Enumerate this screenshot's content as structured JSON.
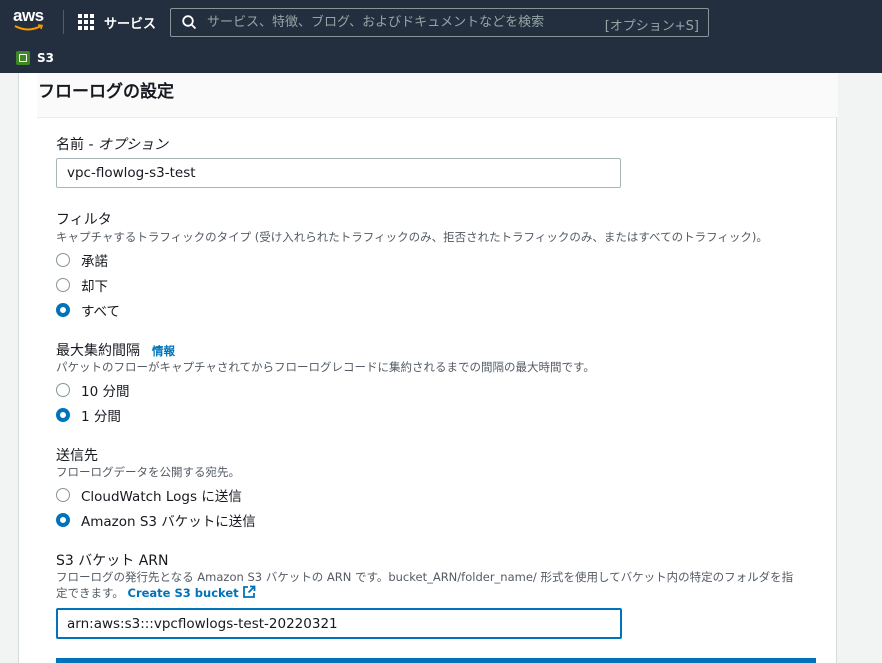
{
  "nav": {
    "logo_text": "aws",
    "services_label": "サービス",
    "search_placeholder": "サービス、特徴、ブログ、およびドキュメントなどを検索",
    "search_shortcut": "[オプション+S]",
    "favorite_label": "S3"
  },
  "panel": {
    "title": "フローログの設定"
  },
  "name_field": {
    "label": "名前 - ",
    "label_optional": "オプション",
    "value": "vpc-flowlog-s3-test"
  },
  "filter": {
    "label": "フィルタ",
    "description": "キャプチャするトラフィックのタイプ (受け入れられたトラフィックのみ、拒否されたトラフィックのみ、またはすべてのトラフィック)。",
    "options": [
      "承諾",
      "却下",
      "すべて"
    ],
    "selected": "すべて"
  },
  "aggregation": {
    "label": "最大集約間隔",
    "info_link": "情報",
    "description": "パケットのフローがキャプチャされてからフローログレコードに集約されるまでの間隔の最大時間です。",
    "options": [
      "10 分間",
      "1 分間"
    ],
    "selected": "1 分間"
  },
  "destination": {
    "label": "送信先",
    "description": "フローログデータを公開する宛先。",
    "options": [
      "CloudWatch Logs に送信",
      "Amazon S3 バケットに送信"
    ],
    "selected": "Amazon S3 バケットに送信"
  },
  "s3_arn": {
    "label": "S3 バケット ARN",
    "description_line1": "フローログの発行先となる Amazon S3 バケットの ARN です。bucket_ARN/folder_name/ 形式を使用してバケット内の特定のフォルダを指",
    "description_line2": "定できます。",
    "create_link": "Create S3 bucket",
    "value": "arn:aws:s3:::vpcflowlogs-test-20220321"
  },
  "colors": {
    "nav_bg": "#232f3e",
    "accent": "#0073bb",
    "s3_green": "#3f8624"
  }
}
